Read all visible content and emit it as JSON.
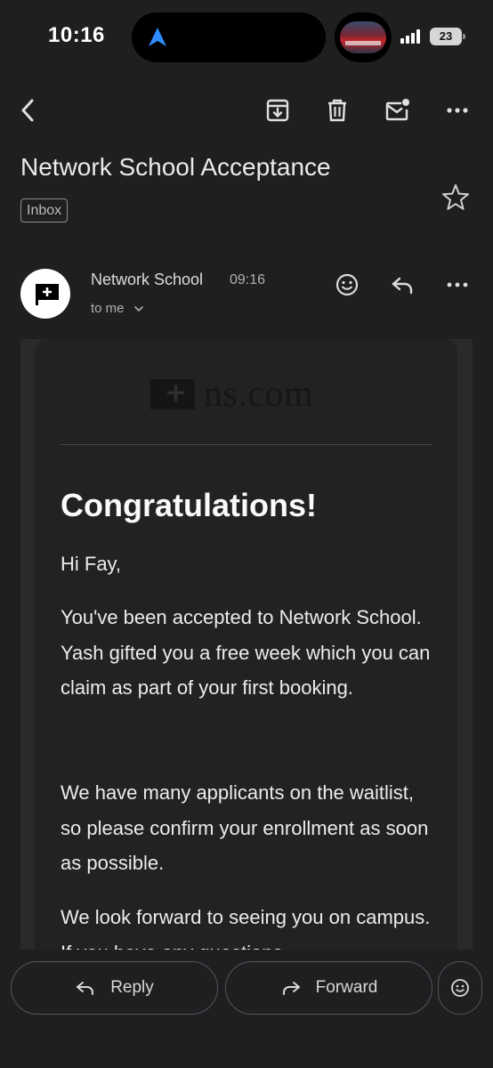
{
  "status_bar": {
    "time": "10:16",
    "battery": "23"
  },
  "toolbar": {
    "back_icon": "chevron-left-icon",
    "archive_icon": "archive-icon",
    "delete_icon": "trash-icon",
    "mark_unread_icon": "mail-unread-icon",
    "more_icon": "more-horizontal-icon"
  },
  "email": {
    "subject": "Network School Acceptance",
    "label": "Inbox",
    "sender_name": "Network School",
    "time": "09:16",
    "recipient": "to me",
    "brand": "ns.com",
    "heading": "Congratulations!",
    "greeting": "Hi Fay,",
    "paragraphs": [
      "You've been accepted to Network School. Yash gifted you a free week which you can claim as part of your first booking.",
      "We have many applicants on the waitlist, so please confirm your enrollment as soon as possible.",
      "We look forward to seeing you on campus. If you have any questions,"
    ]
  },
  "bottom_bar": {
    "reply_label": "Reply",
    "forward_label": "Forward"
  },
  "colors": {
    "background": "#1f1f21",
    "card": "#222225",
    "accent_nav": "#2f8cff"
  }
}
